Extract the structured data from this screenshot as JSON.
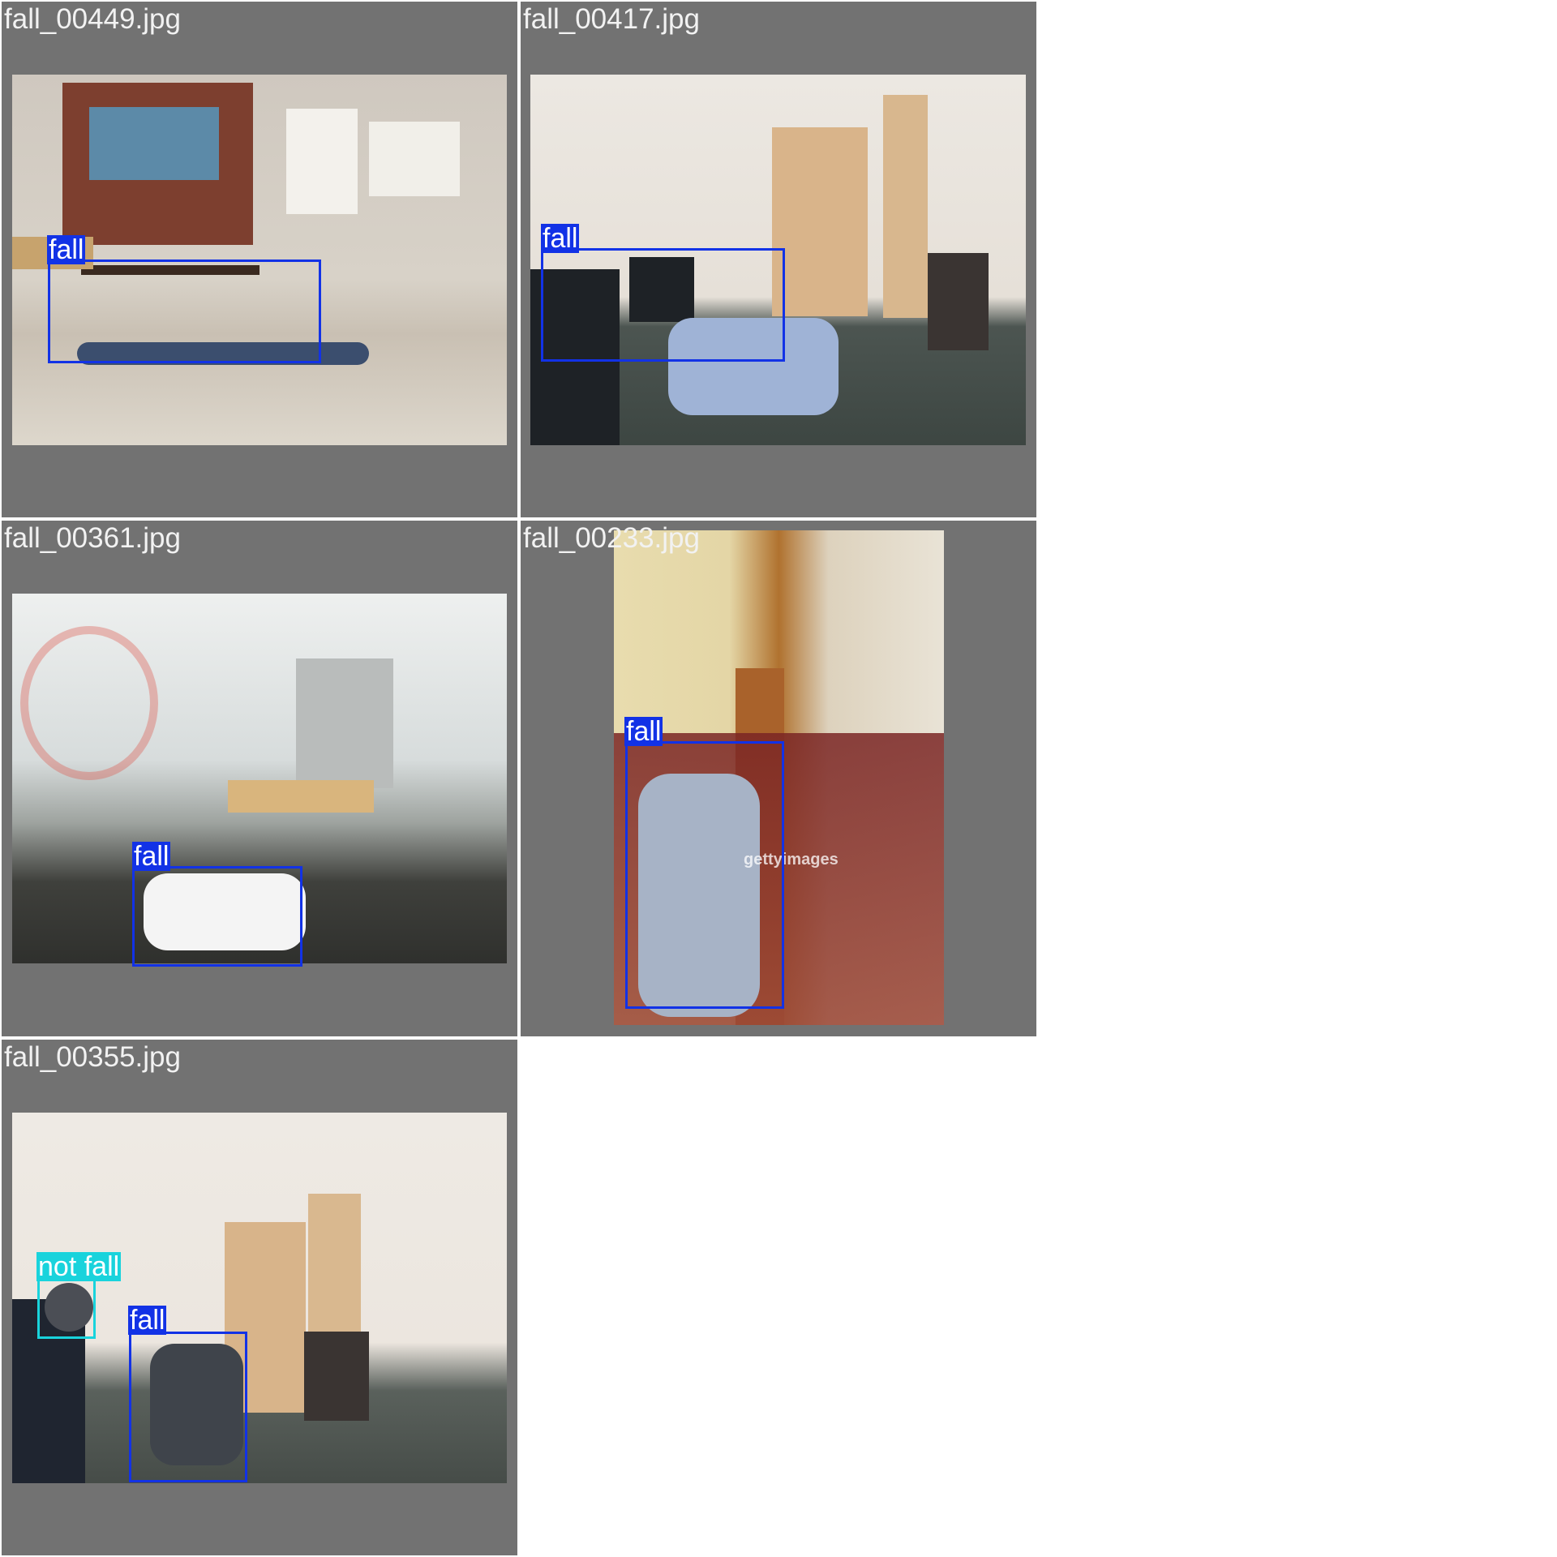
{
  "tiles": [
    {
      "filename": "fall_00449.jpg",
      "detections": [
        {
          "label": "fall",
          "color": "#1232e6"
        }
      ]
    },
    {
      "filename": "fall_00417.jpg",
      "detections": [
        {
          "label": "fall",
          "color": "#1232e6"
        }
      ]
    },
    {
      "filename": "fall_00361.jpg",
      "detections": [
        {
          "label": "fall",
          "color": "#1232e6"
        }
      ]
    },
    {
      "filename": "fall_00233.jpg",
      "detections": [
        {
          "label": "fall",
          "color": "#1232e6"
        }
      ],
      "watermark": "gettyimages"
    },
    {
      "filename": "fall_00355.jpg",
      "detections": [
        {
          "label": "not fall",
          "color": "#19d3dc"
        },
        {
          "label": "fall",
          "color": "#1232e6"
        }
      ]
    }
  ],
  "colors": {
    "tile_background": "#727272",
    "page_background": "#ffffff",
    "fall": "#1232e6",
    "not_fall": "#19d3dc"
  }
}
